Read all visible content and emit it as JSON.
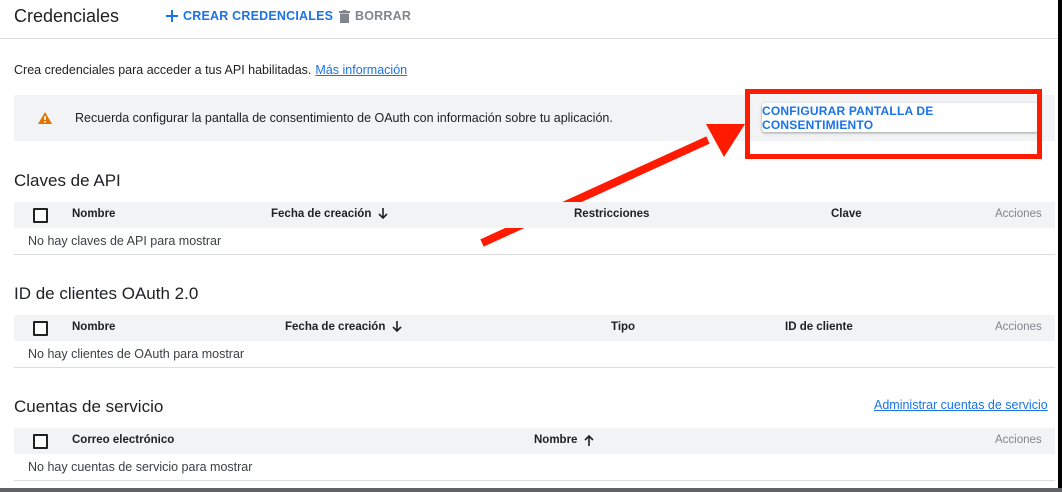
{
  "header": {
    "title": "Credenciales",
    "create_label": "CREAR CREDENCIALES",
    "delete_label": "BORRAR"
  },
  "intro": {
    "text": "Crea credenciales para acceder a tus API habilitadas.",
    "link": "Más información"
  },
  "banner": {
    "text": "Recuerda configurar la pantalla de consentimiento de OAuth con información sobre tu aplicación.",
    "button": "CONFIGURAR PANTALLA DE CONSENTIMIENTO"
  },
  "api_keys": {
    "title": "Claves de API",
    "columns": [
      "Nombre",
      "Fecha de creación",
      "Restricciones",
      "Clave",
      "Acciones"
    ],
    "empty": "No hay claves de API para mostrar"
  },
  "oauth": {
    "title": "ID de clientes OAuth 2.0",
    "columns": [
      "Nombre",
      "Fecha de creación",
      "Tipo",
      "ID de cliente",
      "Acciones"
    ],
    "empty": "No hay clientes de OAuth para mostrar"
  },
  "service": {
    "title": "Cuentas de servicio",
    "manage_link": "Administrar cuentas de servicio",
    "columns": [
      "Correo electrónico",
      "Nombre",
      "Acciones"
    ],
    "empty": "No hay cuentas de servicio para mostrar"
  },
  "icons": {
    "create": "plus-icon",
    "delete": "trash-icon",
    "warning": "warning-icon",
    "sort_desc": "arrow-down-icon",
    "sort_asc": "arrow-up-icon"
  },
  "colors": {
    "accent": "#1a73e8",
    "warning": "#e37400",
    "annotation": "#ff1a00",
    "header_bg": "#f1f3f4"
  }
}
